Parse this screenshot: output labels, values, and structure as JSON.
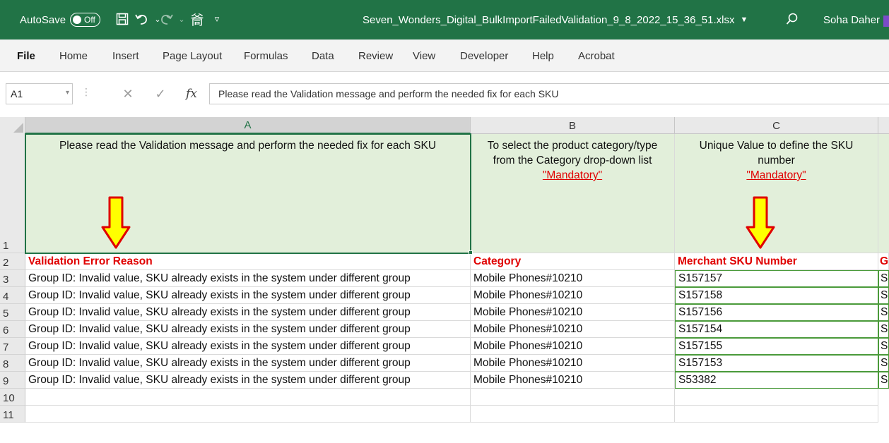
{
  "titlebar": {
    "autosave_label": "AutoSave",
    "autosave_state": "Off",
    "filename": "Seven_Wonders_Digital_BulkImportFailedValidation_9_8_2022_15_36_51.xlsx",
    "user_name": "Soha Daher",
    "accent_color": "#217346"
  },
  "ribbon": {
    "tabs": [
      "File",
      "Home",
      "Insert",
      "Page Layout",
      "Formulas",
      "Data",
      "Review",
      "View",
      "Developer",
      "Help",
      "Acrobat"
    ]
  },
  "formula_bar": {
    "cell_ref": "A1",
    "content": "Please read the Validation message and perform the needed fix for each SKU"
  },
  "grid": {
    "columns": [
      "A",
      "B",
      "C"
    ],
    "row_numbers": [
      "1",
      "2",
      "3",
      "4",
      "5",
      "6",
      "7",
      "8",
      "9",
      "10",
      "11"
    ],
    "header_row": {
      "a": "Please read the Validation message and perform the needed fix for each SKU",
      "b": "To select the product category/type from the Category drop-down list",
      "b_mandatory": "\"Mandatory\"",
      "c": "Unique Value to define the SKU number",
      "c_mandatory": "\"Mandatory\""
    },
    "field_row": {
      "a": "Validation Error Reason",
      "b": "Category",
      "c": "Merchant SKU Number",
      "d": "G"
    },
    "rows": [
      {
        "reason": "Group ID: Invalid value, SKU already exists in the system under different group",
        "category": "Mobile Phones#10210",
        "sku": "S157157",
        "d": "S"
      },
      {
        "reason": "Group ID: Invalid value, SKU already exists in the system under different group",
        "category": "Mobile Phones#10210",
        "sku": "S157158",
        "d": "S"
      },
      {
        "reason": "Group ID: Invalid value, SKU already exists in the system under different group",
        "category": "Mobile Phones#10210",
        "sku": "S157156",
        "d": "S"
      },
      {
        "reason": "Group ID: Invalid value, SKU already exists in the system under different group",
        "category": "Mobile Phones#10210",
        "sku": "S157154",
        "d": "S"
      },
      {
        "reason": "Group ID: Invalid value, SKU already exists in the system under different group",
        "category": "Mobile Phones#10210",
        "sku": "S157155",
        "d": "S"
      },
      {
        "reason": "Group ID: Invalid value, SKU already exists in the system under different group",
        "category": "Mobile Phones#10210",
        "sku": "S157153",
        "d": "S"
      },
      {
        "reason": "Group ID: Invalid value, SKU already exists in the system under different group",
        "category": "Mobile Phones#10210",
        "sku": "S53382",
        "d": "S"
      }
    ]
  },
  "colors": {
    "header_fill": "#e2efda",
    "error_red": "#e00000",
    "arrow_fill": "#ffff00",
    "arrow_stroke": "#e00000"
  }
}
